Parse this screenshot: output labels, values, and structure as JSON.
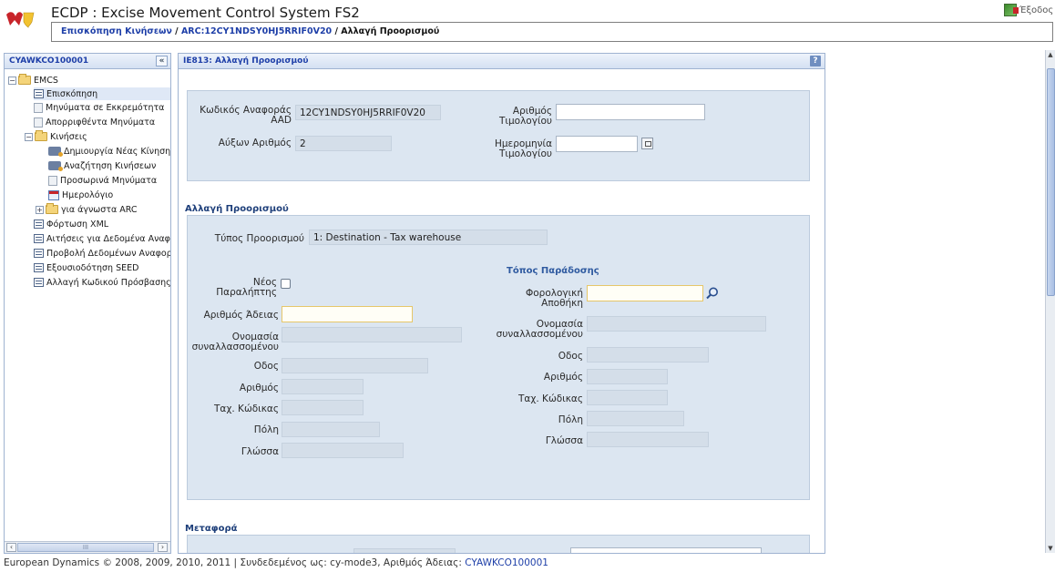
{
  "header": {
    "app_title": "ECDP : Excise Movement Control System FS2",
    "exit_label": "Έξοδος",
    "breadcrumb": {
      "link1": "Επισκόπηση Κινήσεων",
      "sep1": " / ",
      "link2": "ARC:12CY1NDSY0HJ5RRIF0V20",
      "sep2": " / ",
      "current": "Αλλαγή Προορισμού"
    }
  },
  "sidebar": {
    "title": "CYAWKCO100001",
    "collapse_glyph": "«",
    "items": [
      {
        "label": "EMCS"
      },
      {
        "label": "Επισκόπηση"
      },
      {
        "label": "Μηνύματα σε Εκκρεμότητα"
      },
      {
        "label": "Απορριφθέντα Μηνύματα"
      },
      {
        "label": "Κινήσεις"
      },
      {
        "label": "Δημιουργία Νέας Κίνησης"
      },
      {
        "label": "Αναζήτηση Κινήσεων"
      },
      {
        "label": "Προσωρινά Μηνύματα"
      },
      {
        "label": "Ημερολόγιο"
      },
      {
        "label": "για άγνωστα ARC"
      },
      {
        "label": "Φόρτωση XML"
      },
      {
        "label": "Αιτήσεις για Δεδομένα Αναφοράς"
      },
      {
        "label": "Προβολή Δεδομένων Αναφοράς"
      },
      {
        "label": "Εξουσιοδότηση SEED"
      },
      {
        "label": "Αλλαγή Κωδικού Πρόσβασης"
      }
    ],
    "scroll_grip": "III"
  },
  "main": {
    "title": "IE813: Αλλαγή Προορισμού",
    "help": "?",
    "top": {
      "arc_label_1": "Κωδικός Αναφοράς",
      "arc_label_2": "AAD",
      "arc_value": "12CY1NDSY0HJ5RRIF0V20",
      "seq_label": "Αύξων Αριθμός",
      "seq_value": "2",
      "invoice_no_label_1": "Αριθμός",
      "invoice_no_label_2": "Τιμολογίου",
      "invoice_date_label_1": "Ημερομηνία",
      "invoice_date_label_2": "Τιμολογίου"
    },
    "change_dest": {
      "section_title": "Αλλαγή Προορισμού",
      "dest_type_label": "Τύπος Προορισμού",
      "dest_type_value": "1: Destination - Tax warehouse",
      "new_consignee_label_1": "Νέος",
      "new_consignee_label_2": "Παραλήπτης",
      "left": {
        "licence_no": "Αριθμός Άδειας",
        "trader_name_1": "Ονομασία",
        "trader_name_2": "συναλλασσομένου",
        "street": "Οδος",
        "number": "Αριθμός",
        "postcode": "Ταχ. Κώδικας",
        "city": "Πόλη",
        "language": "Γλώσσα"
      },
      "right": {
        "subheading": "Τόπος Παράδοσης",
        "tax_warehouse_1": "Φορολογική",
        "tax_warehouse_2": "Αποθήκη",
        "trader_name_1": "Ονομασία",
        "trader_name_2": "συναλλασσομένου",
        "street": "Οδος",
        "number": "Αριθμός",
        "postcode": "Ταχ. Κώδικας",
        "city": "Πόλη",
        "language": "Γλώσσα"
      }
    },
    "transport": {
      "section_title": "Μεταφορά"
    }
  },
  "footer": {
    "text": "European Dynamics © 2008, 2009, 2010, 2011 | Συνδεδεμένος ως: cy-mode3, Αριθμός Άδειας: ",
    "licence": "CYAWKCO100001"
  },
  "colors": {
    "accent": "#1e3fa8",
    "panel_bg": "#dce6f1",
    "field_bg": "#d4dee9"
  }
}
